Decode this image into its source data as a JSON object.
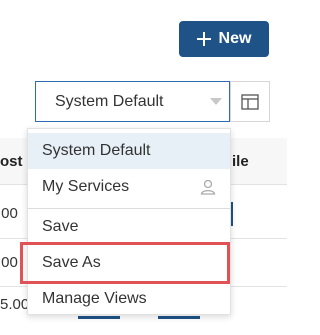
{
  "toolbar": {
    "new_label": "New"
  },
  "view_selector": {
    "selected": "System Default",
    "menu_items": [
      "System Default",
      "My Services",
      "Save",
      "Save As",
      "Manage Views"
    ]
  },
  "table_background": {
    "left_header_fragment": "ost",
    "right_header_fragment": "ile",
    "left_cells": [
      ".00",
      ".00",
      "5.00"
    ]
  },
  "colors": {
    "accent": "#1f5387",
    "highlight": "#e05256",
    "selected_bg": "#e8f0f7"
  },
  "icons": {
    "new": "plus-icon",
    "layout": "table-layout-icon",
    "user": "user-icon",
    "dropdown": "caret-down-icon"
  }
}
